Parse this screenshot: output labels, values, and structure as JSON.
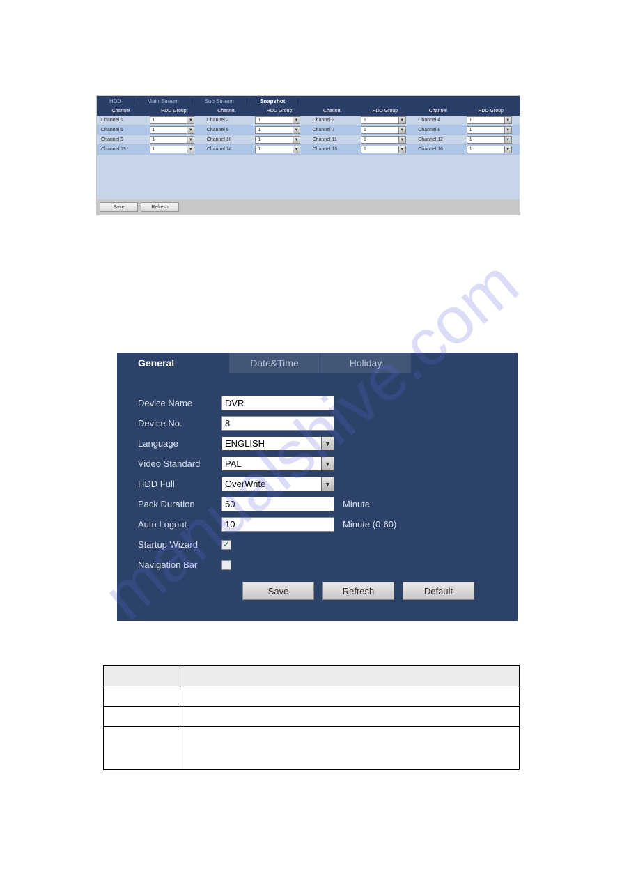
{
  "watermark": "manualshive.com",
  "panel1": {
    "tabs": [
      "HDD",
      "Main Stream",
      "Sub Stream",
      "Snapshot"
    ],
    "active_tab": 3,
    "headers": [
      "Channel",
      "HDD Group",
      "Channel",
      "HDD Group",
      "Channel",
      "HDD Group",
      "Channel",
      "HDD Group"
    ],
    "rows": [
      {
        "c1": "Channel 1",
        "g1": "1",
        "c2": "Channel 2",
        "g2": "1",
        "c3": "Channel 3",
        "g3": "1",
        "c4": "Channel 4",
        "g4": "1"
      },
      {
        "c1": "Channel 5",
        "g1": "1",
        "c2": "Channel 6",
        "g2": "1",
        "c3": "Channel 7",
        "g3": "1",
        "c4": "Channel 8",
        "g4": "1"
      },
      {
        "c1": "Channel 9",
        "g1": "1",
        "c2": "Channel 10",
        "g2": "1",
        "c3": "Channel 11",
        "g3": "1",
        "c4": "Channel 12",
        "g4": "1"
      },
      {
        "c1": "Channel 13",
        "g1": "1",
        "c2": "Channel 14",
        "g2": "1",
        "c3": "Channel 15",
        "g3": "1",
        "c4": "Channel 16",
        "g4": "1"
      }
    ],
    "buttons": {
      "save": "Save",
      "refresh": "Refresh"
    }
  },
  "panel2": {
    "tabs": [
      "General",
      "Date&Time",
      "Holiday"
    ],
    "active_tab": 0,
    "fields": {
      "device_name": {
        "label": "Device Name",
        "value": "DVR"
      },
      "device_no": {
        "label": "Device No.",
        "value": "8"
      },
      "language": {
        "label": "Language",
        "value": "ENGLISH"
      },
      "video_standard": {
        "label": "Video Standard",
        "value": "PAL"
      },
      "hdd_full": {
        "label": "HDD Full",
        "value": "OverWrite"
      },
      "pack_duration": {
        "label": "Pack Duration",
        "value": "60",
        "suffix": "Minute"
      },
      "auto_logout": {
        "label": "Auto Logout",
        "value": "10",
        "suffix": "Minute (0-60)"
      },
      "startup_wizard": {
        "label": "Startup Wizard",
        "checked": true
      },
      "navigation_bar": {
        "label": "Navigation Bar",
        "checked": false
      }
    },
    "buttons": {
      "save": "Save",
      "refresh": "Refresh",
      "default": "Default"
    }
  },
  "icons": {
    "dropdown": "▼",
    "check": "✓"
  }
}
